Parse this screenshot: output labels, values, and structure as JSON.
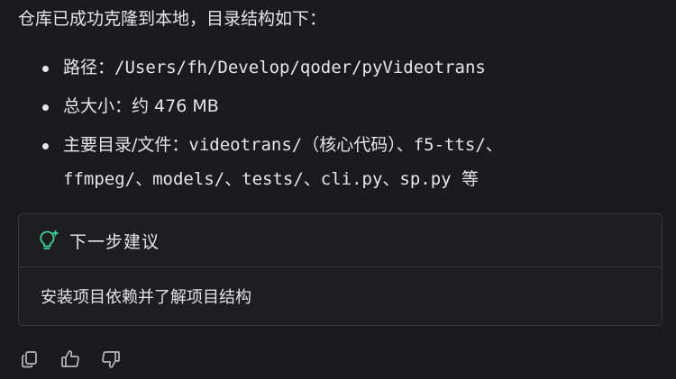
{
  "message": {
    "intro": "仓库已成功克隆到本地，目录结构如下：",
    "items": [
      {
        "label": "路径：",
        "value": "/Users/fh/Develop/qoder/pyVideotrans"
      },
      {
        "label": "总大小：",
        "value": "约 476 MB"
      },
      {
        "label": "主要目录/文件：",
        "value_line1": "videotrans/（核心代码）、f5-tts/、",
        "value_line2": "ffmpeg/、models/、tests/、cli.py、sp.py 等"
      }
    ]
  },
  "suggestion_card": {
    "title": "下一步建议",
    "icon": "lightbulb-sparkle-icon",
    "accent_color": "#3fd19a",
    "suggestion": "安装项目依赖并了解项目结构"
  },
  "actions": [
    {
      "icon": "copy-icon"
    },
    {
      "icon": "thumbs-up-icon"
    },
    {
      "icon": "thumbs-down-icon"
    }
  ]
}
